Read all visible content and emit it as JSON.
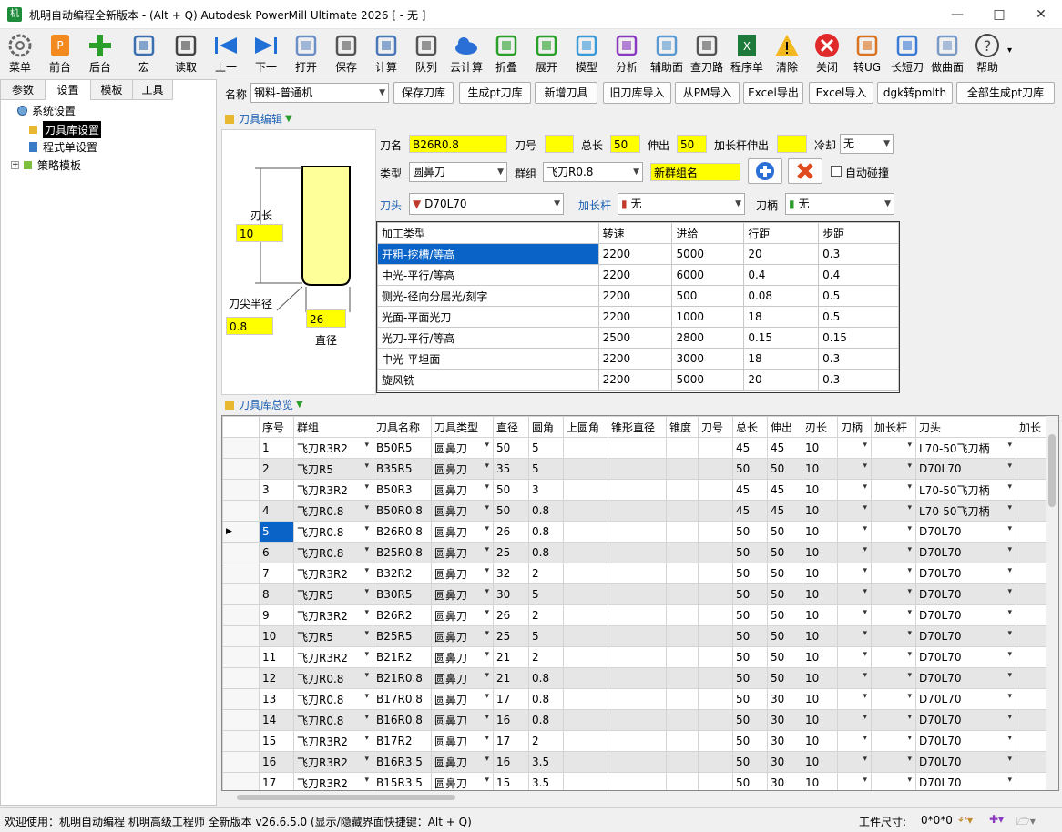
{
  "title": {
    "text": "机明自动编程全新版本 - (Alt + Q) Autodesk PowerMill Ultimate 2026   [ - 无 ]",
    "icon_label": "机明"
  },
  "toolbar": [
    {
      "label": "菜单",
      "icon": "gear-icon"
    },
    {
      "label": "前台",
      "icon": "powermill-icon"
    },
    {
      "label": "后台",
      "icon": "plus-icon"
    },
    {
      "label": "宏",
      "icon": "macro-icon"
    },
    {
      "label": "读取",
      "icon": "sliders-icon"
    },
    {
      "label": "上一",
      "icon": "prev-icon"
    },
    {
      "label": "下一",
      "icon": "next-icon"
    },
    {
      "label": "打开",
      "icon": "folder-icon"
    },
    {
      "label": "保存",
      "icon": "save-icon"
    },
    {
      "label": "计算",
      "icon": "calculator-icon"
    },
    {
      "label": "队列",
      "icon": "queue-icon"
    },
    {
      "label": "云计算",
      "icon": "cloud-icon"
    },
    {
      "label": "折叠",
      "icon": "collapse-icon"
    },
    {
      "label": "展开",
      "icon": "expand-icon"
    },
    {
      "label": "模型",
      "icon": "cube-icon"
    },
    {
      "label": "分析",
      "icon": "analysis-icon"
    },
    {
      "label": "辅助面",
      "icon": "aux-surface-icon"
    },
    {
      "label": "查刀路",
      "icon": "tools-icon"
    },
    {
      "label": "程序单",
      "icon": "excel-icon"
    },
    {
      "label": "清除",
      "icon": "warning-icon"
    },
    {
      "label": "关闭",
      "icon": "close-circle-icon"
    },
    {
      "label": "转UG",
      "icon": "ug-icon"
    },
    {
      "label": "长短刀",
      "icon": "tool-length-icon"
    },
    {
      "label": "做曲面",
      "icon": "surface-icon"
    },
    {
      "label": "帮助",
      "icon": "help-icon"
    }
  ],
  "left_tabs": [
    "参数",
    "设置",
    "模板",
    "工具"
  ],
  "tree": [
    "系统设置",
    "刀具库设置",
    "程式单设置",
    "策略模板"
  ],
  "main_toolbar": {
    "name_label": "名称",
    "library": "钢料-普通机",
    "buttons": [
      "保存刀库",
      "生成pt刀库",
      "新增刀具",
      "旧刀库导入",
      "从PM导入",
      "Excel导出",
      "Excel导入",
      "dgk转pmlth",
      "全部生成pt刀库"
    ]
  },
  "editor": {
    "section_title": "刀具编辑",
    "tool_name_label": "刀名",
    "tool_name": "B26R0.8",
    "tool_no_label": "刀号",
    "tool_no": "",
    "total_len_label": "总长",
    "total_len": "50",
    "stickout_label": "伸出",
    "stickout": "50",
    "ext_stickout_label": "加长杆伸出",
    "ext_stickout": "",
    "coolant_label": "冷却",
    "coolant": "无",
    "type_label": "类型",
    "type": "圆鼻刀",
    "group_label": "群组",
    "group": "飞刀R0.8",
    "new_group": "新群组名",
    "auto_collision": "自动碰撞",
    "head_label": "刀头",
    "head": "D70L70",
    "ext_label": "加长杆",
    "ext": "无",
    "holder_label": "刀柄",
    "holder": "无"
  },
  "diagram": {
    "blade_len_label": "刃长",
    "blade_len": "10",
    "tip_radius_label": "刀尖半径",
    "tip_radius": "0.8",
    "diameter": "26",
    "diameter_label": "直径"
  },
  "ops": {
    "headers": [
      "加工类型",
      "转速",
      "进给",
      "行距",
      "步距"
    ],
    "rows": [
      [
        "开粗-挖槽/等高",
        "2200",
        "5000",
        "20",
        "0.3"
      ],
      [
        "中光-平行/等高",
        "2200",
        "6000",
        "0.4",
        "0.4"
      ],
      [
        "侧光-径向分层光/刻字",
        "2200",
        "500",
        "0.08",
        "0.5"
      ],
      [
        "光面-平面光刀",
        "2200",
        "1000",
        "18",
        "0.5"
      ],
      [
        "光刀-平行/等高",
        "2500",
        "2800",
        "0.15",
        "0.15"
      ],
      [
        "中光-平坦面",
        "2200",
        "3000",
        "18",
        "0.3"
      ],
      [
        "旋风铣",
        "2200",
        "5000",
        "20",
        "0.3"
      ]
    ]
  },
  "overview": {
    "section_title": "刀具库总览",
    "headers": [
      "序号",
      "群组",
      "刀具名称",
      "刀具类型",
      "直径",
      "圆角",
      "上圆角",
      "锥形直径",
      "锥度",
      "刀号",
      "总长",
      "伸出",
      "刃长",
      "刀柄",
      "加长杆",
      "刀头",
      "加长"
    ],
    "rows": [
      [
        "1",
        "飞刀R3R2",
        "B50R5",
        "圆鼻刀",
        "50",
        "5",
        "",
        "",
        "",
        "",
        "45",
        "45",
        "10",
        "",
        "",
        "L70-50飞刀柄"
      ],
      [
        "2",
        "飞刀R5",
        "B35R5",
        "圆鼻刀",
        "35",
        "5",
        "",
        "",
        "",
        "",
        "50",
        "50",
        "10",
        "",
        "",
        "D70L70"
      ],
      [
        "3",
        "飞刀R3R2",
        "B50R3",
        "圆鼻刀",
        "50",
        "3",
        "",
        "",
        "",
        "",
        "45",
        "45",
        "10",
        "",
        "",
        "L70-50飞刀柄"
      ],
      [
        "4",
        "飞刀R0.8",
        "B50R0.8",
        "圆鼻刀",
        "50",
        "0.8",
        "",
        "",
        "",
        "",
        "45",
        "45",
        "10",
        "",
        "",
        "L70-50飞刀柄"
      ],
      [
        "5",
        "飞刀R0.8",
        "B26R0.8",
        "圆鼻刀",
        "26",
        "0.8",
        "",
        "",
        "",
        "",
        "50",
        "50",
        "10",
        "",
        "",
        "D70L70"
      ],
      [
        "6",
        "飞刀R0.8",
        "B25R0.8",
        "圆鼻刀",
        "25",
        "0.8",
        "",
        "",
        "",
        "",
        "50",
        "50",
        "10",
        "",
        "",
        "D70L70"
      ],
      [
        "7",
        "飞刀R3R2",
        "B32R2",
        "圆鼻刀",
        "32",
        "2",
        "",
        "",
        "",
        "",
        "50",
        "50",
        "10",
        "",
        "",
        "D70L70"
      ],
      [
        "8",
        "飞刀R5",
        "B30R5",
        "圆鼻刀",
        "30",
        "5",
        "",
        "",
        "",
        "",
        "50",
        "50",
        "10",
        "",
        "",
        "D70L70"
      ],
      [
        "9",
        "飞刀R3R2",
        "B26R2",
        "圆鼻刀",
        "26",
        "2",
        "",
        "",
        "",
        "",
        "50",
        "50",
        "10",
        "",
        "",
        "D70L70"
      ],
      [
        "10",
        "飞刀R5",
        "B25R5",
        "圆鼻刀",
        "25",
        "5",
        "",
        "",
        "",
        "",
        "50",
        "50",
        "10",
        "",
        "",
        "D70L70"
      ],
      [
        "11",
        "飞刀R3R2",
        "B21R2",
        "圆鼻刀",
        "21",
        "2",
        "",
        "",
        "",
        "",
        "50",
        "50",
        "10",
        "",
        "",
        "D70L70"
      ],
      [
        "12",
        "飞刀R0.8",
        "B21R0.8",
        "圆鼻刀",
        "21",
        "0.8",
        "",
        "",
        "",
        "",
        "50",
        "50",
        "10",
        "",
        "",
        "D70L70"
      ],
      [
        "13",
        "飞刀R0.8",
        "B17R0.8",
        "圆鼻刀",
        "17",
        "0.8",
        "",
        "",
        "",
        "",
        "50",
        "30",
        "10",
        "",
        "",
        "D70L70"
      ],
      [
        "14",
        "飞刀R0.8",
        "B16R0.8",
        "圆鼻刀",
        "16",
        "0.8",
        "",
        "",
        "",
        "",
        "50",
        "30",
        "10",
        "",
        "",
        "D70L70"
      ],
      [
        "15",
        "飞刀R3R2",
        "B17R2",
        "圆鼻刀",
        "17",
        "2",
        "",
        "",
        "",
        "",
        "50",
        "30",
        "10",
        "",
        "",
        "D70L70"
      ],
      [
        "16",
        "飞刀R3R2",
        "B16R3.5",
        "圆鼻刀",
        "16",
        "3.5",
        "",
        "",
        "",
        "",
        "50",
        "30",
        "10",
        "",
        "",
        "D70L70"
      ],
      [
        "17",
        "飞刀R3R2",
        "B15R3.5",
        "圆鼻刀",
        "15",
        "3.5",
        "",
        "",
        "",
        "",
        "50",
        "30",
        "10",
        "",
        "",
        "D70L70"
      ]
    ]
  },
  "status": {
    "welcome": "欢迎使用：机明自动编程 机明高级工程师 全新版本 v26.6.5.0  (显示/隐藏界面快捷键：Alt + Q)",
    "size_label": "工件尺寸:",
    "size": "0*0*0"
  }
}
